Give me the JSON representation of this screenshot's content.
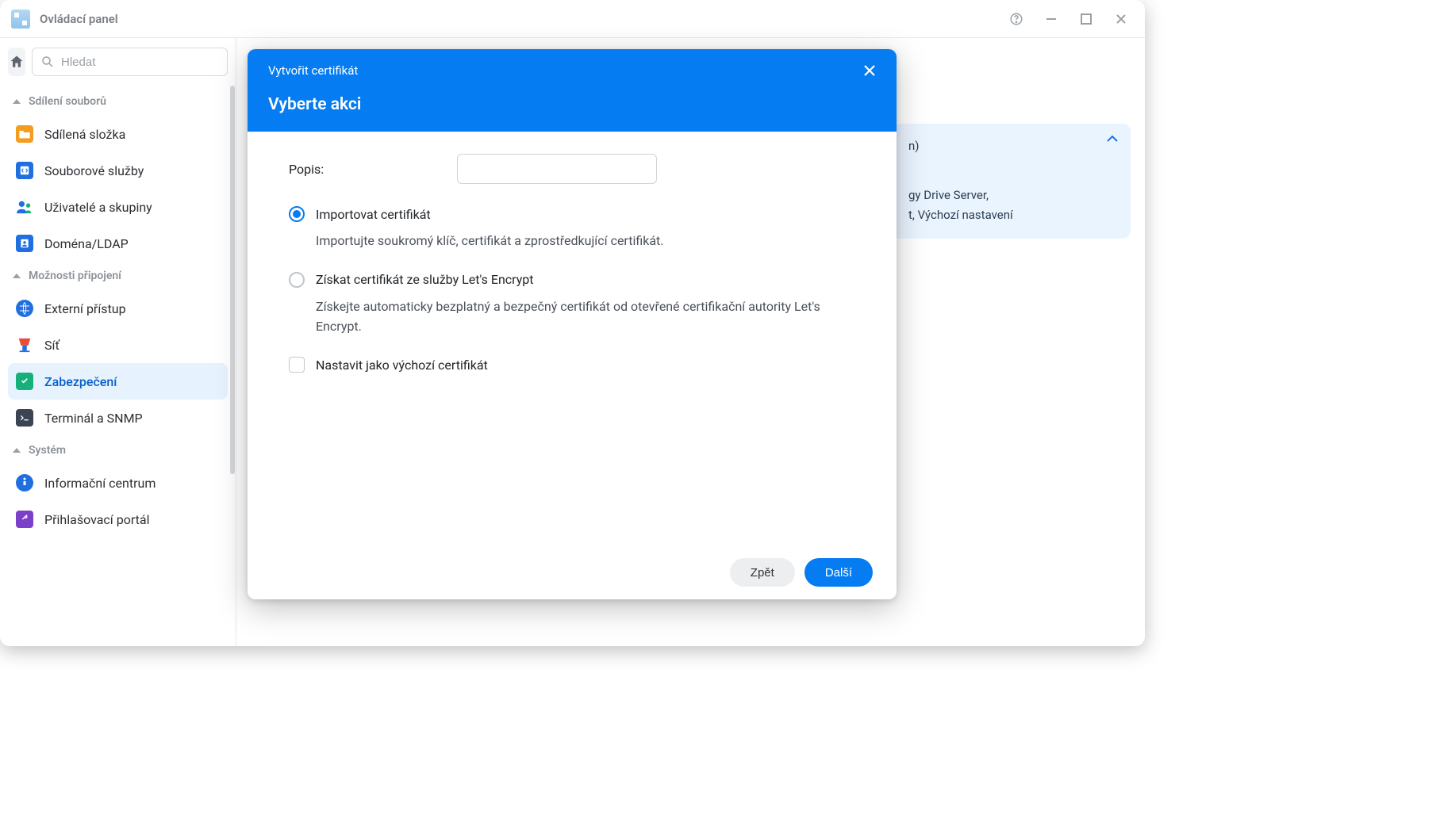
{
  "window": {
    "title": "Ovládací panel"
  },
  "search": {
    "placeholder": "Hledat"
  },
  "sections": {
    "fileSharing": "Sdílení souborů",
    "connectivity": "Možnosti připojení",
    "system": "Systém"
  },
  "nav": {
    "sharedFolder": "Sdílená složka",
    "fileServices": "Souborové služby",
    "usersGroups": "Uživatelé a skupiny",
    "domainLdap": "Doména/LDAP",
    "externalAccess": "Externí přístup",
    "network": "Síť",
    "security": "Zabezpečení",
    "terminalSnmp": "Terminál a SNMP",
    "infoCenter": "Informační centrum",
    "loginPortal": "Přihlašovací portál"
  },
  "backgroundCard": {
    "line1": "n)",
    "line2": "gy Drive Server,",
    "line3": "t, Výchozí nastavení"
  },
  "modal": {
    "breadcrumb": "Vytvořit certifikát",
    "title": "Vyberte akci",
    "descriptionLabel": "Popis:",
    "option1Label": "Importovat certifikát",
    "option1Desc": "Importujte soukromý klíč, certifikát a zprostředkující certifikát.",
    "option2Label": "Získat certifikát ze služby Let's Encrypt",
    "option2Desc": "Získejte automaticky bezplatný a bezpečný certifikát od otevřené certifikační autority Let's Encrypt.",
    "defaultCheckbox": "Nastavit jako výchozí certifikát",
    "backBtn": "Zpět",
    "nextBtn": "Další",
    "descriptionValue": ""
  }
}
